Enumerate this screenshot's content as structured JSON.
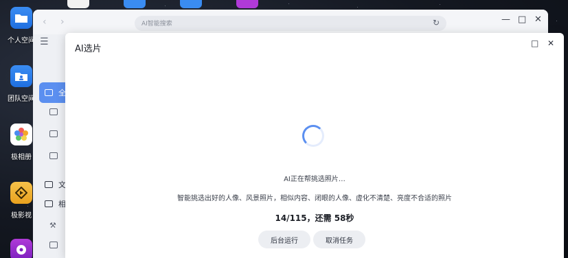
{
  "desktop": {
    "icons": [
      {
        "name": "personal-space",
        "label": "个人空间",
        "icon": "folder-icon"
      },
      {
        "name": "team-space",
        "label": "团队空间",
        "icon": "team-folder-icon"
      },
      {
        "name": "photo-album",
        "label": "极相册",
        "icon": "photos-icon"
      },
      {
        "name": "video",
        "label": "极影视",
        "icon": "video-icon"
      },
      {
        "name": "music",
        "label": "",
        "icon": "music-icon"
      }
    ]
  },
  "app_window": {
    "search_placeholder": "AI智能搜索",
    "sidebar_active_label": "全",
    "sidebar_items": [
      "文",
      "相"
    ]
  },
  "dialog": {
    "title": "AI选片",
    "status_line": "AI正在帮挑选照片…",
    "description": "智能挑选出好的人像、风景照片，相似内容、闭眼的人像、虚化不清楚、亮度不合适的照片",
    "progress_text": "14/115，还需 58秒",
    "progress": {
      "done": 14,
      "total": 115
    },
    "buttons": {
      "background": "后台运行",
      "cancel": "取消任务"
    }
  },
  "colors": {
    "accent": "#5b8ff0",
    "dialog_bg": "#ffffff",
    "window_bg": "#eef0f4"
  }
}
